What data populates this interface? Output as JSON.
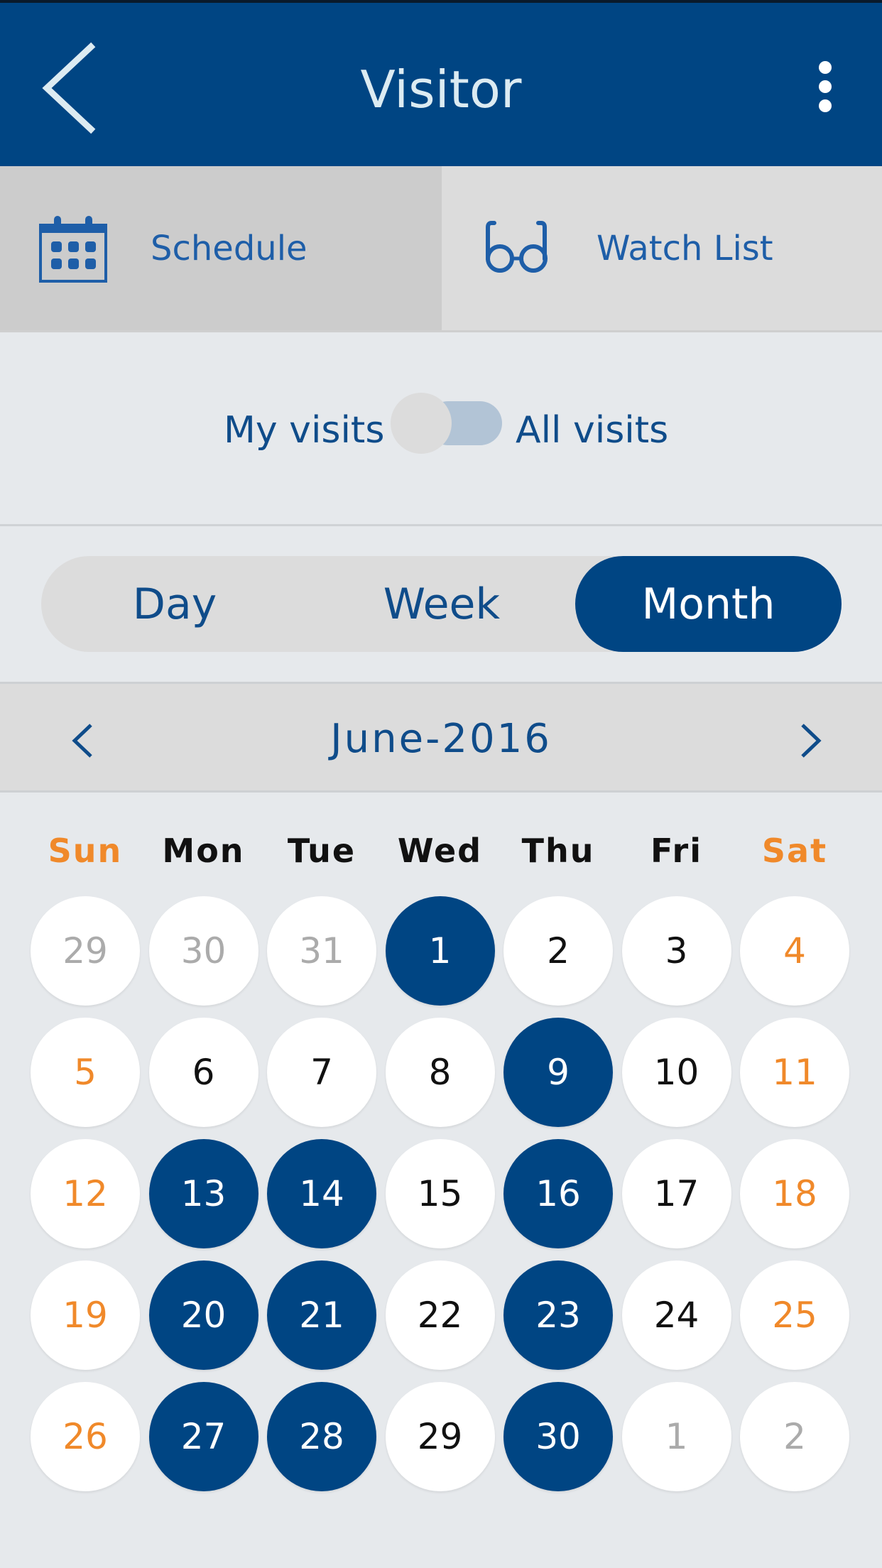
{
  "header": {
    "title": "Visitor",
    "back_icon": "chevron-left-icon",
    "menu_icon": "more-vertical-icon"
  },
  "tabs": [
    {
      "label": "Schedule",
      "icon": "calendar-icon",
      "active": true
    },
    {
      "label": "Watch List",
      "icon": "glasses-icon",
      "active": false
    }
  ],
  "visit_filter": {
    "left_label": "My visits",
    "right_label": "All visits",
    "selected": "My visits"
  },
  "view_modes": {
    "options": [
      "Day",
      "Week",
      "Month"
    ],
    "selected": "Month"
  },
  "month_nav": {
    "label": "June-2016",
    "prev_icon": "chevron-left-icon",
    "next_icon": "chevron-right-icon"
  },
  "calendar": {
    "weekdays": [
      "Sun",
      "Mon",
      "Tue",
      "Wed",
      "Thu",
      "Fri",
      "Sat"
    ],
    "weekend_color": "#F0892A",
    "event_color": "#004583",
    "weeks": [
      [
        {
          "d": "29",
          "t": "muted"
        },
        {
          "d": "30",
          "t": "muted"
        },
        {
          "d": "31",
          "t": "muted"
        },
        {
          "d": "1",
          "t": "event"
        },
        {
          "d": "2",
          "t": "normal"
        },
        {
          "d": "3",
          "t": "normal"
        },
        {
          "d": "4",
          "t": "weekend"
        }
      ],
      [
        {
          "d": "5",
          "t": "weekend"
        },
        {
          "d": "6",
          "t": "normal"
        },
        {
          "d": "7",
          "t": "normal"
        },
        {
          "d": "8",
          "t": "normal"
        },
        {
          "d": "9",
          "t": "event"
        },
        {
          "d": "10",
          "t": "normal"
        },
        {
          "d": "11",
          "t": "weekend"
        }
      ],
      [
        {
          "d": "12",
          "t": "weekend"
        },
        {
          "d": "13",
          "t": "event"
        },
        {
          "d": "14",
          "t": "event"
        },
        {
          "d": "15",
          "t": "normal"
        },
        {
          "d": "16",
          "t": "event"
        },
        {
          "d": "17",
          "t": "normal"
        },
        {
          "d": "18",
          "t": "weekend"
        }
      ],
      [
        {
          "d": "19",
          "t": "weekend"
        },
        {
          "d": "20",
          "t": "event"
        },
        {
          "d": "21",
          "t": "event"
        },
        {
          "d": "22",
          "t": "normal"
        },
        {
          "d": "23",
          "t": "event"
        },
        {
          "d": "24",
          "t": "normal"
        },
        {
          "d": "25",
          "t": "weekend"
        }
      ],
      [
        {
          "d": "26",
          "t": "weekend"
        },
        {
          "d": "27",
          "t": "event"
        },
        {
          "d": "28",
          "t": "event"
        },
        {
          "d": "29",
          "t": "normal"
        },
        {
          "d": "30",
          "t": "event"
        },
        {
          "d": "1",
          "t": "muted"
        },
        {
          "d": "2",
          "t": "muted"
        }
      ]
    ]
  },
  "colors": {
    "primary": "#004583",
    "accent_orange": "#F0892A",
    "text_blue": "#0F4C8A",
    "muted_text": "#ABABAB"
  }
}
